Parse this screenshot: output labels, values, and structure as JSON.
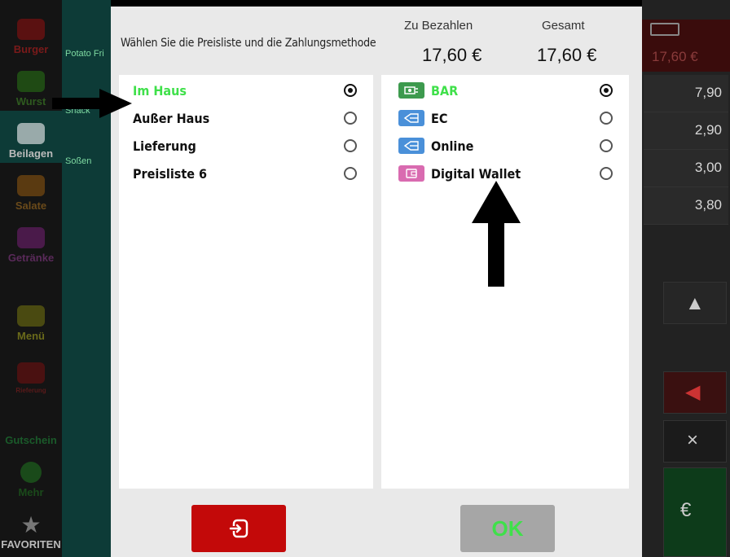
{
  "background": {
    "categories": [
      {
        "label": "Burger",
        "color": "#8a1a1a",
        "icon": "burger-icon"
      },
      {
        "label": "Wurst",
        "color": "#2e6b1f",
        "icon": "sausage-icon"
      },
      {
        "label": "Beilagen",
        "color": "#cccccc",
        "icon": "fries-icon"
      },
      {
        "label": "Salate",
        "color": "#8a5a1a",
        "icon": "salad-icon"
      },
      {
        "label": "Getränke",
        "color": "#7a2a7a",
        "icon": "drink-icon"
      },
      {
        "label": "Menü",
        "color": "#8a8a1a",
        "icon": "menu-icon"
      },
      {
        "label": "Rieferung",
        "color": "#7a1a1a",
        "icon": "delivery-icon"
      },
      {
        "label": "Gutschein",
        "color": "#1a6a2a",
        "icon": "voucher-icon"
      },
      {
        "label": "Mehr",
        "color": "#1a7a1a",
        "icon": "pumpkin-icon"
      },
      {
        "label": "FAVORITEN",
        "color": "#aaaaaa",
        "icon": "star-icon"
      }
    ],
    "col2_items": [
      "Potato Fri",
      "Snack",
      "Soßen"
    ],
    "total": "17,60 €",
    "prices": [
      "7,90",
      "2,90",
      "3,00",
      "3,80"
    ]
  },
  "modal": {
    "title": "Wählen Sie die Preisliste und die Zahlungsmethode",
    "to_pay_label": "Zu Bezahlen",
    "to_pay_value": "17,60 €",
    "total_label": "Gesamt",
    "total_value": "17,60 €",
    "price_lists": [
      {
        "label": "Im Haus",
        "selected": true
      },
      {
        "label": "Außer Haus",
        "selected": false
      },
      {
        "label": "Lieferung",
        "selected": false
      },
      {
        "label": "Preisliste 6",
        "selected": false
      }
    ],
    "payment_methods": [
      {
        "label": "BAR",
        "selected": true,
        "icon": "cash-icon",
        "icon_color": "#3d9a4e"
      },
      {
        "label": "EC",
        "selected": false,
        "icon": "card-icon",
        "icon_color": "#4a90d9"
      },
      {
        "label": "Online",
        "selected": false,
        "icon": "card-icon",
        "icon_color": "#4a90d9"
      },
      {
        "label": "Digital Wallet",
        "selected": false,
        "icon": "wallet-icon",
        "icon_color": "#d96bb0"
      }
    ],
    "exit_button_icon": "exit-icon",
    "ok_label": "OK"
  }
}
